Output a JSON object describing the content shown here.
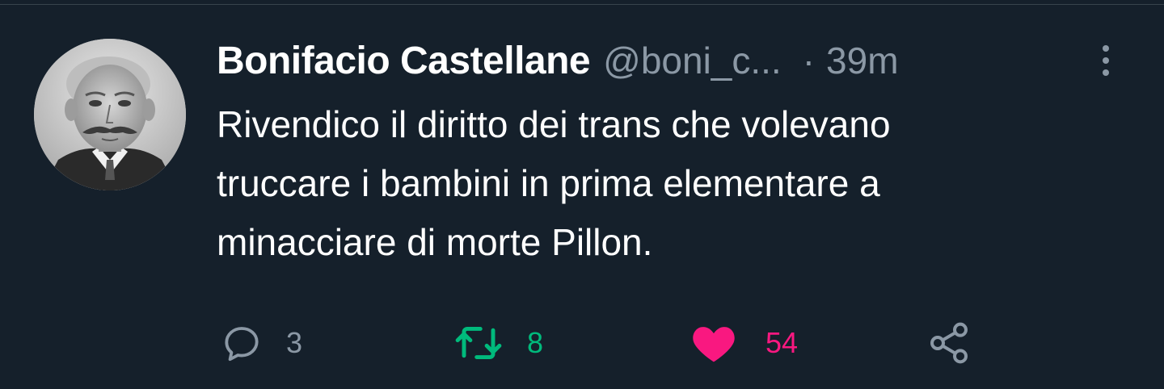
{
  "tweet": {
    "display_name": "Bonifacio Castellane",
    "handle": "@boni_c...",
    "separator": "·",
    "time": "39m",
    "text_lines": [
      "Rivendico il diritto dei trans che volevano",
      "truccare i bambini in prima elementare a",
      "minacciare di morte Pillon."
    ]
  },
  "actions": {
    "reply_count": "3",
    "retweet_count": "8",
    "like_count": "54"
  },
  "icons": {
    "reply": "reply-icon",
    "retweet": "retweet-icon",
    "like": "heart-icon",
    "share": "share-icon",
    "more": "more-icon"
  },
  "colors": {
    "background": "#15202b",
    "secondary_text": "#8b98a5",
    "retweet": "#00ba7c",
    "like": "#f91880"
  }
}
